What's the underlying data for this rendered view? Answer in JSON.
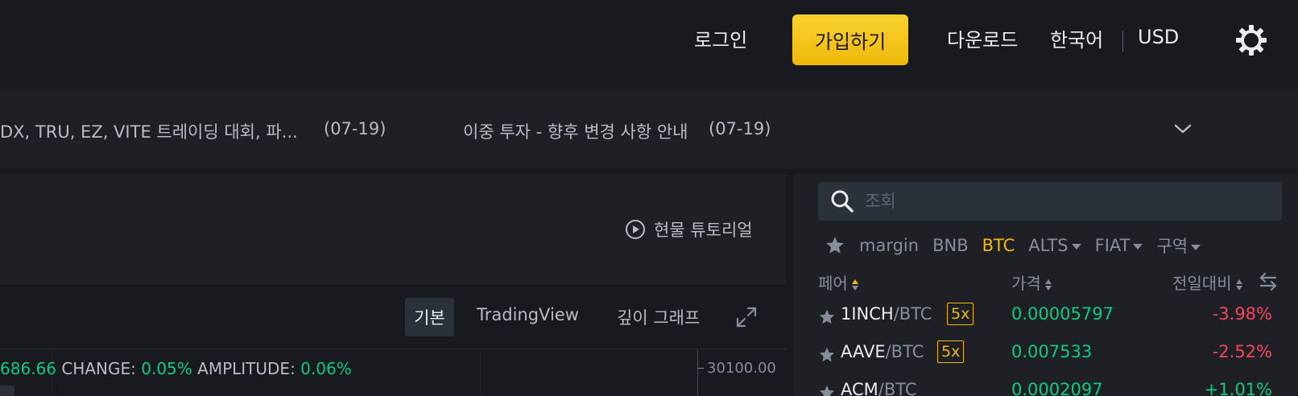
{
  "header": {
    "login_label": "로그인",
    "signup_label": "가입하기",
    "download_label": "다운로드",
    "language_label": "한국어",
    "currency_label": "USD",
    "settings_icon": "gear-icon"
  },
  "announcements": [
    {
      "text": "DX, TRU, EZ, VITE 트레이딩 대회, 파...",
      "date": "(07-19)"
    },
    {
      "text": "이중 투자 - 향후 변경 사항 안내",
      "date": "(07-19)"
    }
  ],
  "tutorial": {
    "label": "현물 튜토리얼",
    "icon": "play-circle-icon"
  },
  "chart_tabs": {
    "basic": "기본",
    "tradingview": "TradingView",
    "depth": "깊이 그래프"
  },
  "stats": {
    "price_fragment": "686.66",
    "change_label": "CHANGE:",
    "change_value": "0.05%",
    "amplitude_label": "AMPLITUDE:",
    "amplitude_value": "0.06%",
    "axis_tick": "30100.00"
  },
  "market": {
    "search_placeholder": "조회",
    "tabs": [
      {
        "label": "margin",
        "dropdown": false,
        "active": false
      },
      {
        "label": "BNB",
        "dropdown": false,
        "active": false
      },
      {
        "label": "BTC",
        "dropdown": false,
        "active": true
      },
      {
        "label": "ALTS",
        "dropdown": true,
        "active": false
      },
      {
        "label": "FIAT",
        "dropdown": true,
        "active": false
      },
      {
        "label": "구역",
        "dropdown": true,
        "active": false
      }
    ],
    "columns": {
      "pair": "페어",
      "price": "가격",
      "change": "전일대비"
    },
    "rows": [
      {
        "base": "1INCH",
        "quote": "/BTC",
        "leverage": "5x",
        "price": "0.00005797",
        "change": "-3.98%",
        "direction": "down"
      },
      {
        "base": "AAVE",
        "quote": "/BTC",
        "leverage": "5x",
        "price": "0.007533",
        "change": "-2.52%",
        "direction": "down"
      },
      {
        "base": "ACM",
        "quote": "/BTC",
        "leverage": "",
        "price": "0.0002097",
        "change": "+1.01%",
        "direction": "up"
      }
    ]
  },
  "colors": {
    "accent": "#f0b90b",
    "up": "#0ecb81",
    "down": "#f6465d",
    "background": "#181a20",
    "panel": "#1e2026"
  }
}
